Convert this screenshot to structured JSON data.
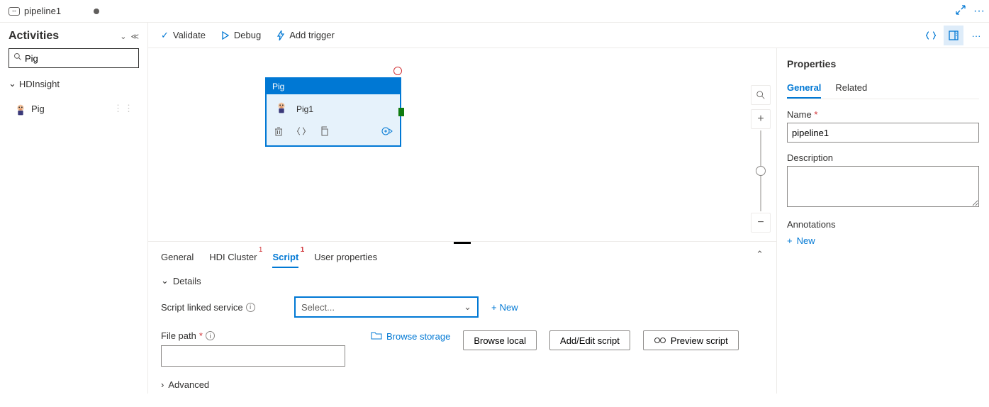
{
  "tab": {
    "title": "pipeline1"
  },
  "sidebar": {
    "title": "Activities",
    "search_value": "Pig",
    "category": "HDInsight",
    "item_label": "Pig"
  },
  "toolbar": {
    "validate": "Validate",
    "debug": "Debug",
    "trigger": "Add trigger"
  },
  "node": {
    "type": "Pig",
    "name": "Pig1"
  },
  "bottom_tabs": {
    "general": "General",
    "hdi": "HDI Cluster",
    "hdi_badge": "1",
    "script": "Script",
    "script_badge": "1",
    "user": "User properties"
  },
  "script_panel": {
    "details": "Details",
    "linked_label": "Script linked service",
    "select_placeholder": "Select...",
    "new": "New",
    "filepath_label": "File path",
    "browse_storage": "Browse storage",
    "browse_local": "Browse local",
    "addedit": "Add/Edit script",
    "preview": "Preview script",
    "advanced": "Advanced"
  },
  "props": {
    "title": "Properties",
    "tab_general": "General",
    "tab_related": "Related",
    "name_label": "Name",
    "name_value": "pipeline1",
    "desc_label": "Description",
    "ann_label": "Annotations",
    "new": "New"
  }
}
